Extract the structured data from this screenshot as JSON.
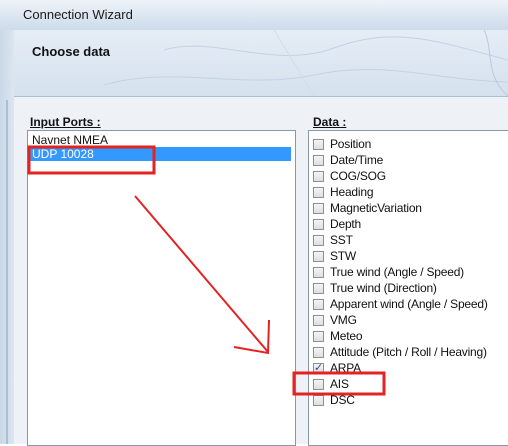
{
  "window": {
    "title": "Connection Wizard"
  },
  "header": {
    "title": "Choose data"
  },
  "input_ports": {
    "label": "Input Ports :",
    "items": [
      {
        "label": "Navnet NMEA",
        "selected": false
      },
      {
        "label": "UDP 10028",
        "selected": true
      }
    ]
  },
  "data_list": {
    "label": "Data :",
    "items": [
      {
        "label": "Position",
        "checked": false
      },
      {
        "label": "Date/Time",
        "checked": false
      },
      {
        "label": "COG/SOG",
        "checked": false
      },
      {
        "label": "Heading",
        "checked": false
      },
      {
        "label": "MagneticVariation",
        "checked": false
      },
      {
        "label": "Depth",
        "checked": false
      },
      {
        "label": "SST",
        "checked": false
      },
      {
        "label": "STW",
        "checked": false
      },
      {
        "label": "True wind (Angle / Speed)",
        "checked": false
      },
      {
        "label": "True wind (Direction)",
        "checked": false
      },
      {
        "label": "Apparent wind (Angle / Speed)",
        "checked": false
      },
      {
        "label": "VMG",
        "checked": false
      },
      {
        "label": "Meteo",
        "checked": false
      },
      {
        "label": "Attitude (Pitch / Roll / Heaving)",
        "checked": false
      },
      {
        "label": "ARPA",
        "checked": true
      },
      {
        "label": "AIS",
        "checked": false
      },
      {
        "label": "DSC",
        "checked": false
      }
    ]
  },
  "colors": {
    "annotation": "#e32222",
    "selection": "#3399ff"
  }
}
